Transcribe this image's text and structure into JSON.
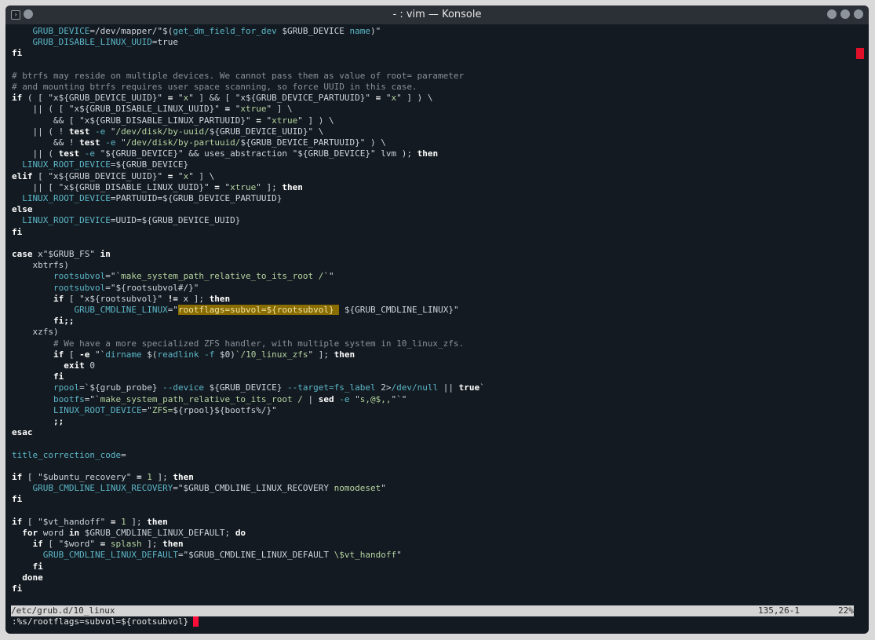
{
  "window": {
    "title": "- : vim — Konsole"
  },
  "editor": {
    "lines": [
      {
        "indent": "    ",
        "tokens": [
          {
            "t": "GRUB_DEVICE",
            "c": "var"
          },
          {
            "t": "=/dev/mapper/\"$("
          },
          {
            "t": "get_dm_field_for_dev",
            "c": "var"
          },
          {
            "t": " $GRUB_DEVICE "
          },
          {
            "t": "name",
            "c": "var"
          },
          {
            "t": ")\""
          }
        ]
      },
      {
        "indent": "    ",
        "tokens": [
          {
            "t": "GRUB_DISABLE_LINUX_UUID",
            "c": "var"
          },
          {
            "t": "=true"
          }
        ]
      },
      {
        "indent": "",
        "tokens": [
          {
            "t": "fi",
            "c": "kw"
          }
        ]
      },
      {
        "indent": "",
        "tokens": []
      },
      {
        "indent": "",
        "tokens": [
          {
            "t": "# btrfs may reside on multiple devices. We cannot pass them as value of root= parameter",
            "c": "cmt"
          }
        ]
      },
      {
        "indent": "",
        "tokens": [
          {
            "t": "# and mounting btrfs requires user space scanning, so force UUID in this case.",
            "c": "cmt"
          }
        ]
      },
      {
        "indent": "",
        "tokens": [
          {
            "t": "if",
            "c": "kw"
          },
          {
            "t": " ( [ \"x${GRUB_DEVICE_UUID}\" "
          },
          {
            "t": "=",
            "c": "kw"
          },
          {
            "t": " \""
          },
          {
            "t": "x",
            "c": "str"
          },
          {
            "t": "\" ] && [ \"x${GRUB_DEVICE_PARTUUID}\" "
          },
          {
            "t": "=",
            "c": "kw"
          },
          {
            "t": " \""
          },
          {
            "t": "x",
            "c": "str"
          },
          {
            "t": "\" ] ) \\"
          }
        ]
      },
      {
        "indent": "    ",
        "tokens": [
          {
            "t": "|| ( [ \"x${GRUB_DISABLE_LINUX_UUID}\" "
          },
          {
            "t": "=",
            "c": "kw"
          },
          {
            "t": " \""
          },
          {
            "t": "xtrue",
            "c": "str"
          },
          {
            "t": "\" ] \\"
          }
        ]
      },
      {
        "indent": "        ",
        "tokens": [
          {
            "t": "&& [ \"x${GRUB_DISABLE_LINUX_PARTUUID}\" "
          },
          {
            "t": "=",
            "c": "kw"
          },
          {
            "t": " \""
          },
          {
            "t": "xtrue",
            "c": "str"
          },
          {
            "t": "\" ] ) \\"
          }
        ]
      },
      {
        "indent": "    ",
        "tokens": [
          {
            "t": "|| ( ! "
          },
          {
            "t": "test",
            "c": "kw"
          },
          {
            "t": " "
          },
          {
            "t": "-e",
            "c": "var"
          },
          {
            "t": " \""
          },
          {
            "t": "/dev/disk/by-uuid/",
            "c": "str"
          },
          {
            "t": "${GRUB_DEVICE_UUID}\" \\"
          }
        ]
      },
      {
        "indent": "        ",
        "tokens": [
          {
            "t": "&& ! "
          },
          {
            "t": "test",
            "c": "kw"
          },
          {
            "t": " "
          },
          {
            "t": "-e",
            "c": "var"
          },
          {
            "t": " \""
          },
          {
            "t": "/dev/disk/by-partuuid/",
            "c": "str"
          },
          {
            "t": "${GRUB_DEVICE_PARTUUID}\" ) \\"
          }
        ]
      },
      {
        "indent": "    ",
        "tokens": [
          {
            "t": "|| ( "
          },
          {
            "t": "test",
            "c": "kw"
          },
          {
            "t": " "
          },
          {
            "t": "-e",
            "c": "var"
          },
          {
            "t": " \"${GRUB_DEVICE}\" && uses_abstraction \"${GRUB_DEVICE}\" lvm ); "
          },
          {
            "t": "then",
            "c": "kw"
          }
        ]
      },
      {
        "indent": "  ",
        "tokens": [
          {
            "t": "LINUX_ROOT_DEVICE",
            "c": "var"
          },
          {
            "t": "=${GRUB_DEVICE}"
          }
        ]
      },
      {
        "indent": "",
        "tokens": [
          {
            "t": "elif",
            "c": "kw"
          },
          {
            "t": " [ \"x${GRUB_DEVICE_UUID}\" "
          },
          {
            "t": "=",
            "c": "kw"
          },
          {
            "t": " \""
          },
          {
            "t": "x",
            "c": "str"
          },
          {
            "t": "\" ] \\"
          }
        ]
      },
      {
        "indent": "    ",
        "tokens": [
          {
            "t": "|| [ \"x${GRUB_DISABLE_LINUX_UUID}\" "
          },
          {
            "t": "=",
            "c": "kw"
          },
          {
            "t": " \""
          },
          {
            "t": "xtrue",
            "c": "str"
          },
          {
            "t": "\" ]; "
          },
          {
            "t": "then",
            "c": "kw"
          }
        ]
      },
      {
        "indent": "  ",
        "tokens": [
          {
            "t": "LINUX_ROOT_DEVICE",
            "c": "var"
          },
          {
            "t": "=PARTUUID=${GRUB_DEVICE_PARTUUID}"
          }
        ]
      },
      {
        "indent": "",
        "tokens": [
          {
            "t": "else",
            "c": "kw"
          }
        ]
      },
      {
        "indent": "  ",
        "tokens": [
          {
            "t": "LINUX_ROOT_DEVICE",
            "c": "var"
          },
          {
            "t": "=UUID=${GRUB_DEVICE_UUID}"
          }
        ]
      },
      {
        "indent": "",
        "tokens": [
          {
            "t": "fi",
            "c": "kw"
          }
        ]
      },
      {
        "indent": "",
        "tokens": []
      },
      {
        "indent": "",
        "tokens": [
          {
            "t": "case",
            "c": "kw"
          },
          {
            "t": " x\"$GRUB_FS\" "
          },
          {
            "t": "in",
            "c": "kw"
          }
        ]
      },
      {
        "indent": "    ",
        "tokens": [
          {
            "t": "xbtrfs)"
          }
        ]
      },
      {
        "indent": "        ",
        "tokens": [
          {
            "t": "rootsubvol",
            "c": "var"
          },
          {
            "t": "=\"`"
          },
          {
            "t": "make_system_path_relative_to_its_root /",
            "c": "str"
          },
          {
            "t": "`\""
          }
        ]
      },
      {
        "indent": "        ",
        "tokens": [
          {
            "t": "rootsubvol",
            "c": "var"
          },
          {
            "t": "=\"${rootsubvol#/}\""
          }
        ]
      },
      {
        "indent": "        ",
        "tokens": [
          {
            "t": "if",
            "c": "kw"
          },
          {
            "t": " [ \"x${rootsubvol}\" "
          },
          {
            "t": "!=",
            "c": "kw"
          },
          {
            "t": " x ]; "
          },
          {
            "t": "then",
            "c": "kw"
          }
        ]
      },
      {
        "indent": "            ",
        "tokens": [
          {
            "t": "GRUB_CMDLINE_LINUX",
            "c": "var"
          },
          {
            "t": "=\""
          },
          {
            "t": "rootflags=subvol=${rootsubvol} ",
            "c": "hl"
          },
          {
            "t": " ${GRUB_CMDLINE_LINUX}\""
          }
        ]
      },
      {
        "indent": "        ",
        "tokens": [
          {
            "t": "fi;;",
            "c": "kw"
          }
        ]
      },
      {
        "indent": "    ",
        "tokens": [
          {
            "t": "xzfs)"
          }
        ]
      },
      {
        "indent": "        ",
        "tokens": [
          {
            "t": "# We have a more specialized ZFS handler, with multiple system in 10_linux_zfs.",
            "c": "cmt"
          }
        ]
      },
      {
        "indent": "        ",
        "tokens": [
          {
            "t": "if",
            "c": "kw"
          },
          {
            "t": " [ "
          },
          {
            "t": "-e",
            "c": "kw"
          },
          {
            "t": " \"`"
          },
          {
            "t": "dirname",
            "c": "var"
          },
          {
            "t": " $("
          },
          {
            "t": "readlink",
            "c": "var"
          },
          {
            "t": " "
          },
          {
            "t": "-f",
            "c": "var"
          },
          {
            "t": " $0)"
          },
          {
            "t": "`/10_linux_zfs",
            "c": "str"
          },
          {
            "t": "\" ]; "
          },
          {
            "t": "then",
            "c": "kw"
          }
        ]
      },
      {
        "indent": "          ",
        "tokens": [
          {
            "t": "exit",
            "c": "kw"
          },
          {
            "t": " 0"
          }
        ]
      },
      {
        "indent": "        ",
        "tokens": [
          {
            "t": "fi",
            "c": "kw"
          }
        ]
      },
      {
        "indent": "        ",
        "tokens": [
          {
            "t": "rpool",
            "c": "var"
          },
          {
            "t": "=`${grub_probe} "
          },
          {
            "t": "--device",
            "c": "var"
          },
          {
            "t": " ${GRUB_DEVICE} "
          },
          {
            "t": "--target=fs_label",
            "c": "var"
          },
          {
            "t": " 2>"
          },
          {
            "t": "/dev/null",
            "c": "var"
          },
          {
            "t": " || "
          },
          {
            "t": "true",
            "c": "kw"
          },
          {
            "t": "`"
          }
        ]
      },
      {
        "indent": "        ",
        "tokens": [
          {
            "t": "bootfs",
            "c": "var"
          },
          {
            "t": "=\"`"
          },
          {
            "t": "make_system_path_relative_to_its_root /",
            "c": "str"
          },
          {
            "t": " | "
          },
          {
            "t": "sed",
            "c": "kw"
          },
          {
            "t": " "
          },
          {
            "t": "-e",
            "c": "var"
          },
          {
            "t": " \""
          },
          {
            "t": "s,@$,,",
            "c": "str"
          },
          {
            "t": "\"`\""
          }
        ]
      },
      {
        "indent": "        ",
        "tokens": [
          {
            "t": "LINUX_ROOT_DEVICE",
            "c": "var"
          },
          {
            "t": "=\""
          },
          {
            "t": "ZFS=",
            "c": "str"
          },
          {
            "t": "${rpool}${bootfs%/}\""
          }
        ]
      },
      {
        "indent": "        ",
        "tokens": [
          {
            "t": ";;",
            "c": "kw"
          }
        ]
      },
      {
        "indent": "",
        "tokens": [
          {
            "t": "esac",
            "c": "kw"
          }
        ]
      },
      {
        "indent": "",
        "tokens": []
      },
      {
        "indent": "",
        "tokens": [
          {
            "t": "title_correction_code",
            "c": "var"
          },
          {
            "t": "="
          }
        ]
      },
      {
        "indent": "",
        "tokens": []
      },
      {
        "indent": "",
        "tokens": [
          {
            "t": "if",
            "c": "kw"
          },
          {
            "t": " [ \"$ubuntu_recovery\" "
          },
          {
            "t": "=",
            "c": "kw"
          },
          {
            "t": " "
          },
          {
            "t": "1",
            "c": "str"
          },
          {
            "t": " ]; "
          },
          {
            "t": "then",
            "c": "kw"
          }
        ]
      },
      {
        "indent": "    ",
        "tokens": [
          {
            "t": "GRUB_CMDLINE_LINUX_RECOVERY",
            "c": "var"
          },
          {
            "t": "=\"$GRUB_CMDLINE_LINUX_RECOVERY "
          },
          {
            "t": "nomodeset",
            "c": "str"
          },
          {
            "t": "\""
          }
        ]
      },
      {
        "indent": "",
        "tokens": [
          {
            "t": "fi",
            "c": "kw"
          }
        ]
      },
      {
        "indent": "",
        "tokens": []
      },
      {
        "indent": "",
        "tokens": [
          {
            "t": "if",
            "c": "kw"
          },
          {
            "t": " [ \"$vt_handoff\" "
          },
          {
            "t": "=",
            "c": "kw"
          },
          {
            "t": " "
          },
          {
            "t": "1",
            "c": "str"
          },
          {
            "t": " ]; "
          },
          {
            "t": "then",
            "c": "kw"
          }
        ]
      },
      {
        "indent": "  ",
        "tokens": [
          {
            "t": "for",
            "c": "kw"
          },
          {
            "t": " word "
          },
          {
            "t": "in",
            "c": "kw"
          },
          {
            "t": " $GRUB_CMDLINE_LINUX_DEFAULT; "
          },
          {
            "t": "do",
            "c": "kw"
          }
        ]
      },
      {
        "indent": "    ",
        "tokens": [
          {
            "t": "if",
            "c": "kw"
          },
          {
            "t": " [ \"$word\" "
          },
          {
            "t": "=",
            "c": "kw"
          },
          {
            "t": " "
          },
          {
            "t": "splash",
            "c": "str"
          },
          {
            "t": " ]; "
          },
          {
            "t": "then",
            "c": "kw"
          }
        ]
      },
      {
        "indent": "      ",
        "tokens": [
          {
            "t": "GRUB_CMDLINE_LINUX_DEFAULT",
            "c": "var"
          },
          {
            "t": "=\"$GRUB_CMDLINE_LINUX_DEFAULT "
          },
          {
            "t": "\\$vt_handoff",
            "c": "str"
          },
          {
            "t": "\""
          }
        ]
      },
      {
        "indent": "    ",
        "tokens": [
          {
            "t": "fi",
            "c": "kw"
          }
        ]
      },
      {
        "indent": "  ",
        "tokens": [
          {
            "t": "done",
            "c": "kw"
          }
        ]
      },
      {
        "indent": "",
        "tokens": [
          {
            "t": "fi",
            "c": "kw"
          }
        ]
      }
    ]
  },
  "status": {
    "filename": "/etc/grub.d/10_linux",
    "position": "135,26-1",
    "percent": "22%"
  },
  "command": {
    "text": ":%s/rootflags=subvol=${rootsubvol}"
  },
  "colors": {
    "background": "#131a21",
    "keyword": "#ffffff",
    "variable": "#5cb7c9",
    "string": "#b5d4a0",
    "comment": "#8a919a",
    "search_highlight": "#8a6d00",
    "cursor": "#ff0d3a"
  },
  "icons": {
    "app": "konsole-icon",
    "pin": "pin-icon",
    "minimize": "minimize-icon",
    "maximize": "maximize-icon",
    "close": "close-icon"
  }
}
